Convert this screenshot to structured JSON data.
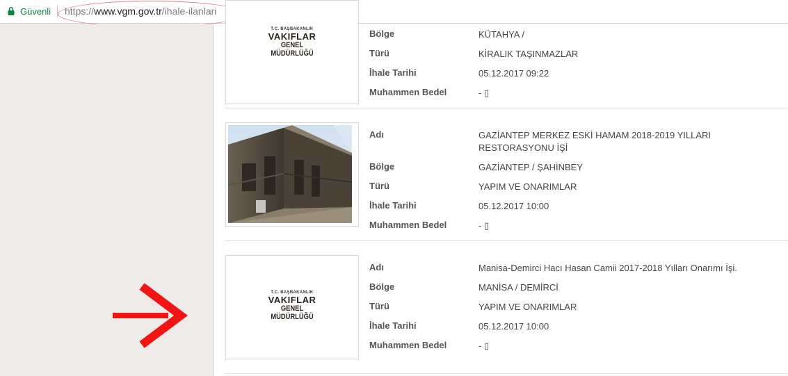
{
  "browser": {
    "secure_label": "Güvenli",
    "url_scheme": "https://",
    "url_host": "www.vgm.gov.tr",
    "url_path": "/ihale-ilanlari"
  },
  "logo": {
    "line1": "T.C. BAŞBAKANLIK",
    "line2": "VAKIFLAR",
    "line3": "GENEL MÜDÜRLÜĞÜ"
  },
  "labels": {
    "name": "Adı",
    "region": "Bölge",
    "type": "Türü",
    "date": "İhale Tarihi",
    "estimated_price": "Muhammen Bedel"
  },
  "listings": [
    {
      "region": "KÜTAHYA /",
      "type": "KİRALIK TAŞINMAZLAR",
      "date": "05.12.2017 09:22",
      "estimated_price": "- ▯"
    },
    {
      "name": "GAZİANTEP MERKEZ ESKİ HAMAM 2018-2019 YILLARI RESTORASYONU İŞİ",
      "region": "GAZİANTEP / ŞAHİNBEY",
      "type": "YAPIM VE ONARIMLAR",
      "date": "05.12.2017 10:00",
      "estimated_price": "- ▯"
    },
    {
      "name": "Manisa-Demirci Hacı Hasan Camii 2017-2018 Yılları Onarımı İşi.",
      "region": "MANİSA / DEMİRCİ",
      "type": "YAPIM VE ONARIMLAR",
      "date": "05.12.2017 10:00",
      "estimated_price": "- ▯"
    }
  ],
  "colors": {
    "secure_green": "#0b8043",
    "sidebar_bg": "#efebe8",
    "highlight_circle": "#e07a7f",
    "arrow_red": "#f01414"
  }
}
